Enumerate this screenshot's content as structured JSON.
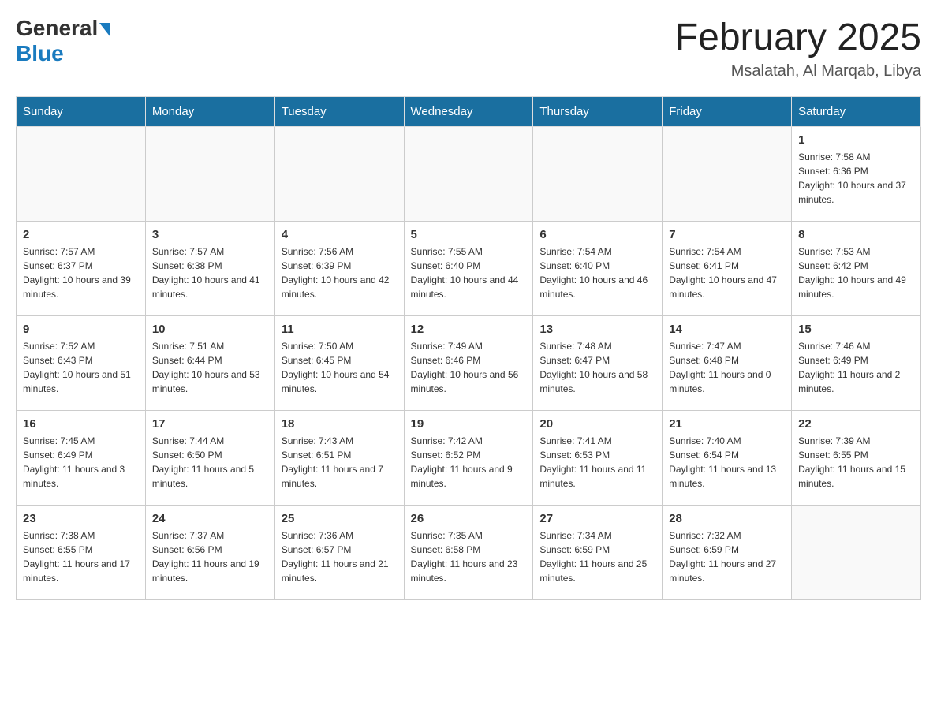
{
  "header": {
    "logo_general": "General",
    "logo_blue": "Blue",
    "title": "February 2025",
    "subtitle": "Msalatah, Al Marqab, Libya"
  },
  "days_of_week": [
    "Sunday",
    "Monday",
    "Tuesday",
    "Wednesday",
    "Thursday",
    "Friday",
    "Saturday"
  ],
  "weeks": [
    [
      {
        "day": "",
        "sunrise": "",
        "sunset": "",
        "daylight": ""
      },
      {
        "day": "",
        "sunrise": "",
        "sunset": "",
        "daylight": ""
      },
      {
        "day": "",
        "sunrise": "",
        "sunset": "",
        "daylight": ""
      },
      {
        "day": "",
        "sunrise": "",
        "sunset": "",
        "daylight": ""
      },
      {
        "day": "",
        "sunrise": "",
        "sunset": "",
        "daylight": ""
      },
      {
        "day": "",
        "sunrise": "",
        "sunset": "",
        "daylight": ""
      },
      {
        "day": "1",
        "sunrise": "Sunrise: 7:58 AM",
        "sunset": "Sunset: 6:36 PM",
        "daylight": "Daylight: 10 hours and 37 minutes."
      }
    ],
    [
      {
        "day": "2",
        "sunrise": "Sunrise: 7:57 AM",
        "sunset": "Sunset: 6:37 PM",
        "daylight": "Daylight: 10 hours and 39 minutes."
      },
      {
        "day": "3",
        "sunrise": "Sunrise: 7:57 AM",
        "sunset": "Sunset: 6:38 PM",
        "daylight": "Daylight: 10 hours and 41 minutes."
      },
      {
        "day": "4",
        "sunrise": "Sunrise: 7:56 AM",
        "sunset": "Sunset: 6:39 PM",
        "daylight": "Daylight: 10 hours and 42 minutes."
      },
      {
        "day": "5",
        "sunrise": "Sunrise: 7:55 AM",
        "sunset": "Sunset: 6:40 PM",
        "daylight": "Daylight: 10 hours and 44 minutes."
      },
      {
        "day": "6",
        "sunrise": "Sunrise: 7:54 AM",
        "sunset": "Sunset: 6:40 PM",
        "daylight": "Daylight: 10 hours and 46 minutes."
      },
      {
        "day": "7",
        "sunrise": "Sunrise: 7:54 AM",
        "sunset": "Sunset: 6:41 PM",
        "daylight": "Daylight: 10 hours and 47 minutes."
      },
      {
        "day": "8",
        "sunrise": "Sunrise: 7:53 AM",
        "sunset": "Sunset: 6:42 PM",
        "daylight": "Daylight: 10 hours and 49 minutes."
      }
    ],
    [
      {
        "day": "9",
        "sunrise": "Sunrise: 7:52 AM",
        "sunset": "Sunset: 6:43 PM",
        "daylight": "Daylight: 10 hours and 51 minutes."
      },
      {
        "day": "10",
        "sunrise": "Sunrise: 7:51 AM",
        "sunset": "Sunset: 6:44 PM",
        "daylight": "Daylight: 10 hours and 53 minutes."
      },
      {
        "day": "11",
        "sunrise": "Sunrise: 7:50 AM",
        "sunset": "Sunset: 6:45 PM",
        "daylight": "Daylight: 10 hours and 54 minutes."
      },
      {
        "day": "12",
        "sunrise": "Sunrise: 7:49 AM",
        "sunset": "Sunset: 6:46 PM",
        "daylight": "Daylight: 10 hours and 56 minutes."
      },
      {
        "day": "13",
        "sunrise": "Sunrise: 7:48 AM",
        "sunset": "Sunset: 6:47 PM",
        "daylight": "Daylight: 10 hours and 58 minutes."
      },
      {
        "day": "14",
        "sunrise": "Sunrise: 7:47 AM",
        "sunset": "Sunset: 6:48 PM",
        "daylight": "Daylight: 11 hours and 0 minutes."
      },
      {
        "day": "15",
        "sunrise": "Sunrise: 7:46 AM",
        "sunset": "Sunset: 6:49 PM",
        "daylight": "Daylight: 11 hours and 2 minutes."
      }
    ],
    [
      {
        "day": "16",
        "sunrise": "Sunrise: 7:45 AM",
        "sunset": "Sunset: 6:49 PM",
        "daylight": "Daylight: 11 hours and 3 minutes."
      },
      {
        "day": "17",
        "sunrise": "Sunrise: 7:44 AM",
        "sunset": "Sunset: 6:50 PM",
        "daylight": "Daylight: 11 hours and 5 minutes."
      },
      {
        "day": "18",
        "sunrise": "Sunrise: 7:43 AM",
        "sunset": "Sunset: 6:51 PM",
        "daylight": "Daylight: 11 hours and 7 minutes."
      },
      {
        "day": "19",
        "sunrise": "Sunrise: 7:42 AM",
        "sunset": "Sunset: 6:52 PM",
        "daylight": "Daylight: 11 hours and 9 minutes."
      },
      {
        "day": "20",
        "sunrise": "Sunrise: 7:41 AM",
        "sunset": "Sunset: 6:53 PM",
        "daylight": "Daylight: 11 hours and 11 minutes."
      },
      {
        "day": "21",
        "sunrise": "Sunrise: 7:40 AM",
        "sunset": "Sunset: 6:54 PM",
        "daylight": "Daylight: 11 hours and 13 minutes."
      },
      {
        "day": "22",
        "sunrise": "Sunrise: 7:39 AM",
        "sunset": "Sunset: 6:55 PM",
        "daylight": "Daylight: 11 hours and 15 minutes."
      }
    ],
    [
      {
        "day": "23",
        "sunrise": "Sunrise: 7:38 AM",
        "sunset": "Sunset: 6:55 PM",
        "daylight": "Daylight: 11 hours and 17 minutes."
      },
      {
        "day": "24",
        "sunrise": "Sunrise: 7:37 AM",
        "sunset": "Sunset: 6:56 PM",
        "daylight": "Daylight: 11 hours and 19 minutes."
      },
      {
        "day": "25",
        "sunrise": "Sunrise: 7:36 AM",
        "sunset": "Sunset: 6:57 PM",
        "daylight": "Daylight: 11 hours and 21 minutes."
      },
      {
        "day": "26",
        "sunrise": "Sunrise: 7:35 AM",
        "sunset": "Sunset: 6:58 PM",
        "daylight": "Daylight: 11 hours and 23 minutes."
      },
      {
        "day": "27",
        "sunrise": "Sunrise: 7:34 AM",
        "sunset": "Sunset: 6:59 PM",
        "daylight": "Daylight: 11 hours and 25 minutes."
      },
      {
        "day": "28",
        "sunrise": "Sunrise: 7:32 AM",
        "sunset": "Sunset: 6:59 PM",
        "daylight": "Daylight: 11 hours and 27 minutes."
      },
      {
        "day": "",
        "sunrise": "",
        "sunset": "",
        "daylight": ""
      }
    ]
  ]
}
